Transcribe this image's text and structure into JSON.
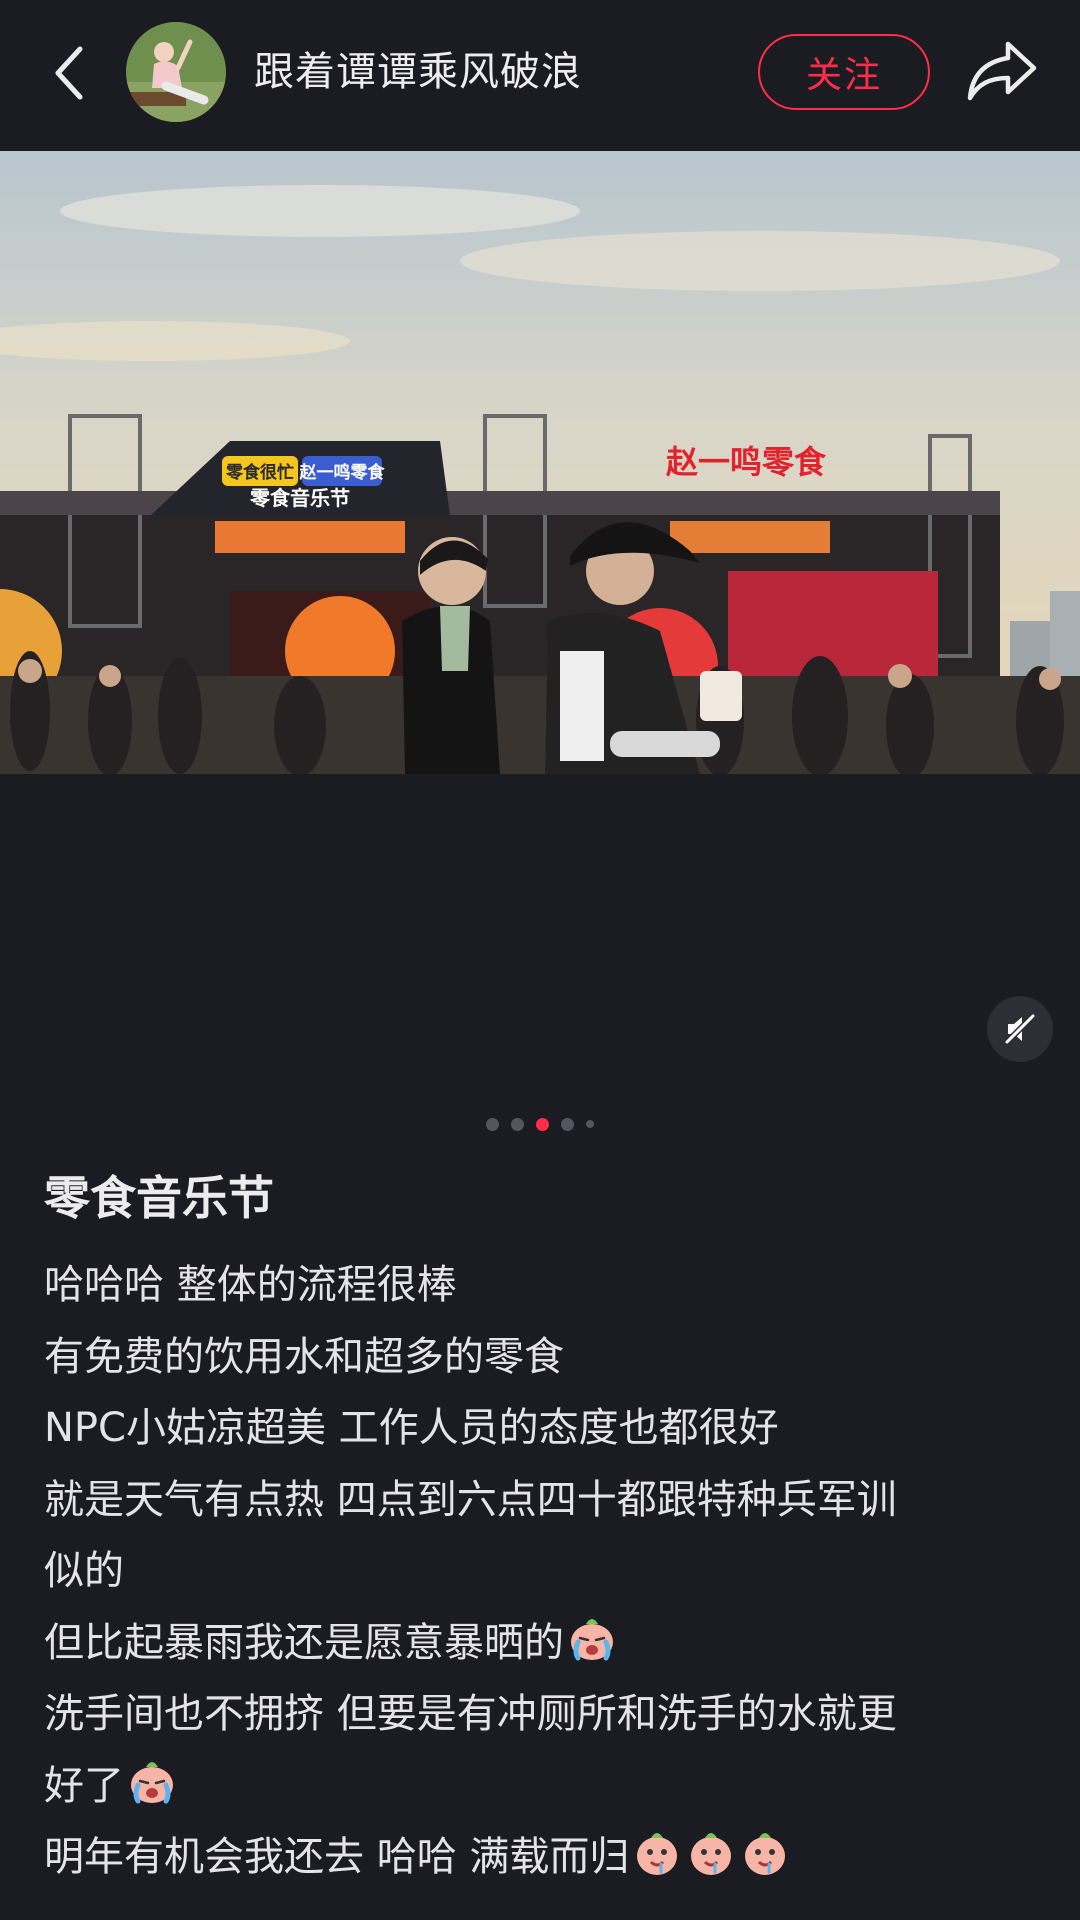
{
  "header": {
    "author_name": "跟着谭谭乘风破浪",
    "follow_label": "关注"
  },
  "photo": {
    "stage_left_sign_1": "零食很忙",
    "stage_left_sign_2": "赵一鸣零食",
    "stage_left_sign_3": "零食音乐节",
    "stage_right_sign": "赵一鸣零食"
  },
  "carousel": {
    "total": 5,
    "active_index": 3
  },
  "note": {
    "title": "零食音乐节",
    "lines": [
      "哈哈哈 整体的流程很棒",
      "有免费的饮用水和超多的零食",
      "NPC小姑凉超美 工作人员的态度也都很好",
      "就是天气有点热 四点到六点四十都跟特种兵军训",
      "似的",
      "但比起暴雨我还是愿意暴晒的",
      "洗手间也不拥挤 但要是有冲厕所和洗手的水就更",
      "好了",
      "明年有机会我还去 哈哈 满载而归"
    ]
  },
  "icons": {
    "back": "chevron-left-icon",
    "share": "share-arrow-icon",
    "mute": "speaker-muted-icon",
    "emoji_cry": "crying-face-emoji",
    "emoji_drool": "drooling-face-emoji"
  },
  "colors": {
    "background": "#1b1b22",
    "accent": "#ff2d4a",
    "text": "#ececef"
  }
}
